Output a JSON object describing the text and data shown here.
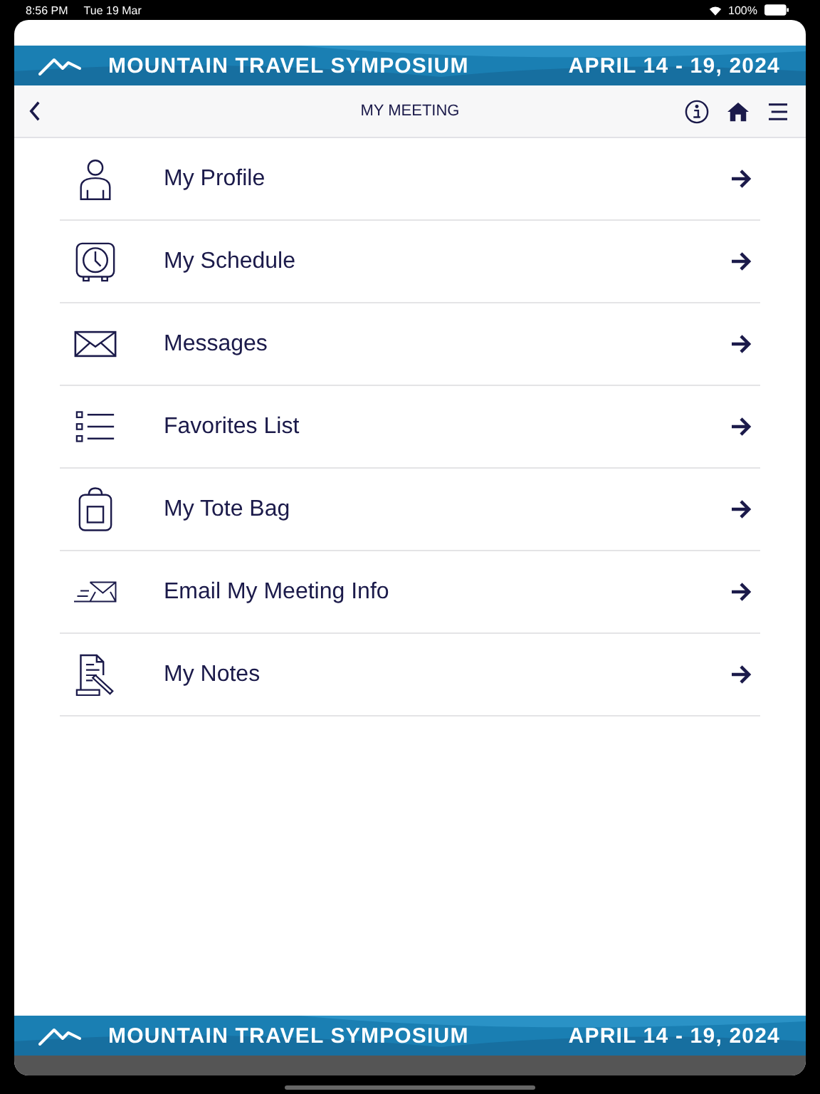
{
  "status_bar": {
    "time": "8:56 PM",
    "date": "Tue 19 Mar",
    "battery": "100%"
  },
  "banner": {
    "title": "MOUNTAIN TRAVEL SYMPOSIUM",
    "dates": "APRIL 14 - 19, 2024"
  },
  "nav": {
    "title": "MY MEETING"
  },
  "menu_items": [
    {
      "kind": "profile",
      "label": "My Profile"
    },
    {
      "kind": "schedule",
      "label": "My Schedule"
    },
    {
      "kind": "messages",
      "label": "Messages"
    },
    {
      "kind": "favorites",
      "label": "Favorites List"
    },
    {
      "kind": "tote",
      "label": "My Tote Bag"
    },
    {
      "kind": "email",
      "label": "Email My Meeting Info"
    },
    {
      "kind": "notes",
      "label": "My Notes"
    }
  ],
  "footer_banner": {
    "title": "MOUNTAIN TRAVEL SYMPOSIUM",
    "dates": "APRIL 14 - 19, 2024"
  }
}
